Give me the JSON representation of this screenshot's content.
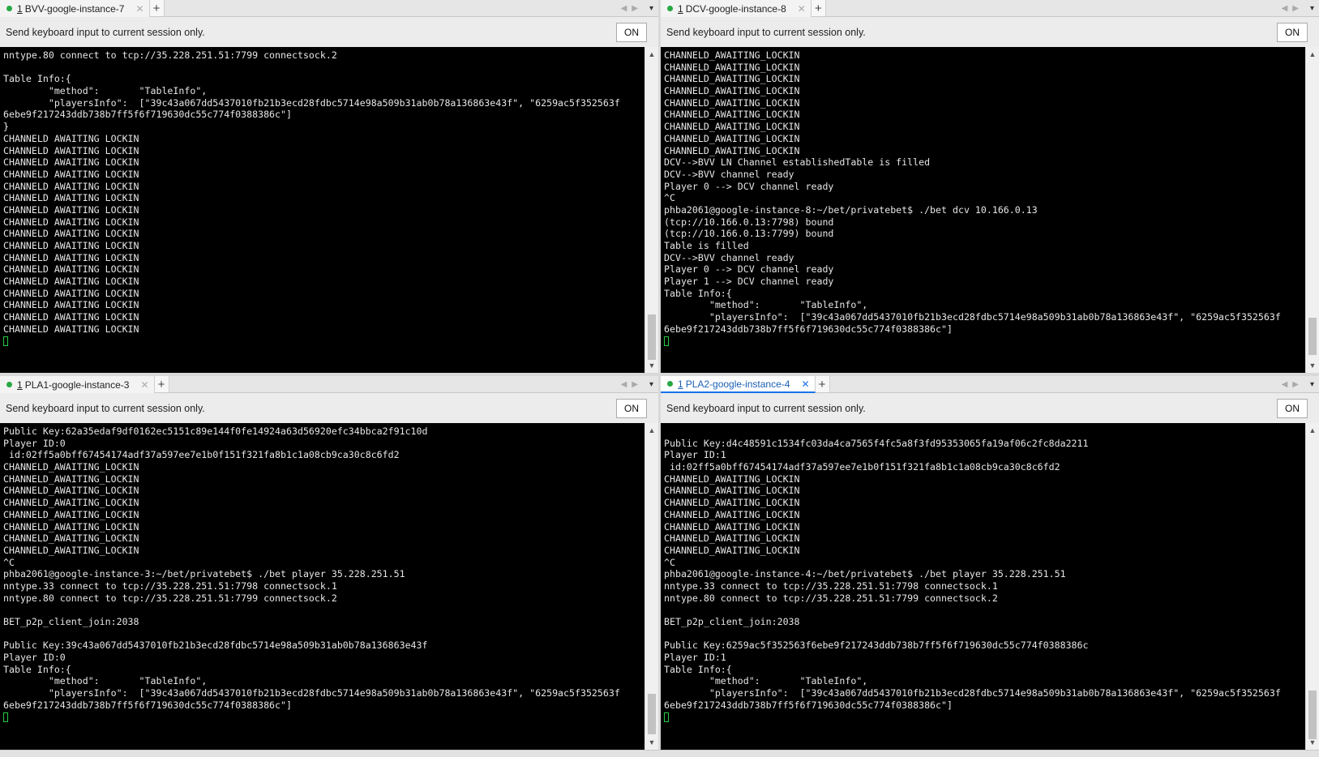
{
  "colors": {
    "active_tab_accent": "#1a73e8",
    "session_dot": "#27a844",
    "terminal_bg": "#000000",
    "terminal_fg": "#e6e6e6",
    "cursor": "#27c93f"
  },
  "icons": {
    "session_status": "green-dot-icon",
    "close": "close-icon",
    "new_tab": "plus-icon",
    "nav_left": "chevron-left-icon",
    "nav_right": "chevron-right-icon",
    "tab_menu": "caret-down-icon"
  },
  "send_label": "Send keyboard input to current session only.",
  "on_label": "ON",
  "tab_glyphs": {
    "close": "✕",
    "new_tab": "+",
    "left": "◀",
    "right": "▶",
    "menu": "▾",
    "scroll_up": "▲",
    "scroll_down": "▼"
  },
  "panes": [
    {
      "tab_num": "1",
      "tab_title": "BVV-google-instance-7",
      "active": false,
      "lines": [
        "nntype.80 connect to tcp://35.228.251.51:7799 connectsock.2",
        "",
        "Table Info:{",
        "        \"method\":       \"TableInfo\",",
        "        \"playersInfo\":  [\"39c43a067dd5437010fb21b3ecd28fdbc5714e98a509b31ab0b78a136863e43f\", \"6259ac5f352563f",
        "6ebe9f217243ddb738b7ff5f6f719630dc55c774f0388386c\"]",
        "}",
        "CHANNELD AWAITING LOCKIN",
        "CHANNELD AWAITING LOCKIN",
        "CHANNELD AWAITING LOCKIN",
        "CHANNELD AWAITING LOCKIN",
        "CHANNELD AWAITING LOCKIN",
        "CHANNELD AWAITING LOCKIN",
        "CHANNELD AWAITING LOCKIN",
        "CHANNELD AWAITING LOCKIN",
        "CHANNELD AWAITING LOCKIN",
        "CHANNELD AWAITING LOCKIN",
        "CHANNELD AWAITING LOCKIN",
        "CHANNELD AWAITING LOCKIN",
        "CHANNELD AWAITING LOCKIN",
        "CHANNELD AWAITING LOCKIN",
        "CHANNELD AWAITING LOCKIN",
        "CHANNELD AWAITING LOCKIN",
        "CHANNELD AWAITING LOCKIN"
      ]
    },
    {
      "tab_num": "1",
      "tab_title": "DCV-google-instance-8",
      "active": false,
      "lines": [
        "CHANNELD_AWAITING_LOCKIN",
        "CHANNELD_AWAITING_LOCKIN",
        "CHANNELD_AWAITING_LOCKIN",
        "CHANNELD_AWAITING_LOCKIN",
        "CHANNELD_AWAITING_LOCKIN",
        "CHANNELD_AWAITING_LOCKIN",
        "CHANNELD_AWAITING_LOCKIN",
        "CHANNELD_AWAITING_LOCKIN",
        "CHANNELD_AWAITING_LOCKIN",
        "DCV-->BVV LN Channel establishedTable is filled",
        "DCV-->BVV channel ready",
        "Player 0 --> DCV channel ready",
        "^C",
        "phba2061@google-instance-8:~/bet/privatebet$ ./bet dcv 10.166.0.13",
        "(tcp://10.166.0.13:7798) bound",
        "(tcp://10.166.0.13:7799) bound",
        "Table is filled",
        "DCV-->BVV channel ready",
        "Player 0 --> DCV channel ready",
        "Player 1 --> DCV channel ready",
        "Table Info:{",
        "        \"method\":       \"TableInfo\",",
        "        \"playersInfo\":  [\"39c43a067dd5437010fb21b3ecd28fdbc5714e98a509b31ab0b78a136863e43f\", \"6259ac5f352563f",
        "6ebe9f217243ddb738b7ff5f6f719630dc55c774f0388386c\"]"
      ]
    },
    {
      "tab_num": "1",
      "tab_title": "PLA1-google-instance-3",
      "active": false,
      "lines": [
        "Public Key:62a35edaf9df0162ec5151c89e144f0fe14924a63d56920efc34bbca2f91c10d",
        "Player ID:0",
        " id:02ff5a0bff67454174adf37a597ee7e1b0f151f321fa8b1c1a08cb9ca30c8c6fd2",
        "CHANNELD_AWAITING_LOCKIN",
        "CHANNELD_AWAITING_LOCKIN",
        "CHANNELD_AWAITING_LOCKIN",
        "CHANNELD_AWAITING_LOCKIN",
        "CHANNELD_AWAITING_LOCKIN",
        "CHANNELD_AWAITING_LOCKIN",
        "CHANNELD_AWAITING_LOCKIN",
        "CHANNELD_AWAITING_LOCKIN",
        "^C",
        "phba2061@google-instance-3:~/bet/privatebet$ ./bet player 35.228.251.51",
        "nntype.33 connect to tcp://35.228.251.51:7798 connectsock.1",
        "nntype.80 connect to tcp://35.228.251.51:7799 connectsock.2",
        "",
        "BET_p2p_client_join:2038",
        "",
        "Public Key:39c43a067dd5437010fb21b3ecd28fdbc5714e98a509b31ab0b78a136863e43f",
        "Player ID:0",
        "Table Info:{",
        "        \"method\":       \"TableInfo\",",
        "        \"playersInfo\":  [\"39c43a067dd5437010fb21b3ecd28fdbc5714e98a509b31ab0b78a136863e43f\", \"6259ac5f352563f",
        "6ebe9f217243ddb738b7ff5f6f719630dc55c774f0388386c\"]"
      ]
    },
    {
      "tab_num": "1",
      "tab_title": "PLA2-google-instance-4",
      "active": true,
      "lines": [
        "",
        "Public Key:d4c48591c1534fc03da4ca7565f4fc5a8f3fd95353065fa19af06c2fc8da2211",
        "Player ID:1",
        " id:02ff5a0bff67454174adf37a597ee7e1b0f151f321fa8b1c1a08cb9ca30c8c6fd2",
        "CHANNELD_AWAITING_LOCKIN",
        "CHANNELD_AWAITING_LOCKIN",
        "CHANNELD_AWAITING_LOCKIN",
        "CHANNELD_AWAITING_LOCKIN",
        "CHANNELD_AWAITING_LOCKIN",
        "CHANNELD_AWAITING_LOCKIN",
        "CHANNELD_AWAITING_LOCKIN",
        "^C",
        "phba2061@google-instance-4:~/bet/privatebet$ ./bet player 35.228.251.51",
        "nntype.33 connect to tcp://35.228.251.51:7798 connectsock.1",
        "nntype.80 connect to tcp://35.228.251.51:7799 connectsock.2",
        "",
        "BET_p2p_client_join:2038",
        "",
        "Public Key:6259ac5f352563f6ebe9f217243ddb738b7ff5f6f719630dc55c774f0388386c",
        "Player ID:1",
        "Table Info:{",
        "        \"method\":       \"TableInfo\",",
        "        \"playersInfo\":  [\"39c43a067dd5437010fb21b3ecd28fdbc5714e98a509b31ab0b78a136863e43f\", \"6259ac5f352563f",
        "6ebe9f217243ddb738b7ff5f6f719630dc55c774f0388386c\"]"
      ]
    }
  ]
}
